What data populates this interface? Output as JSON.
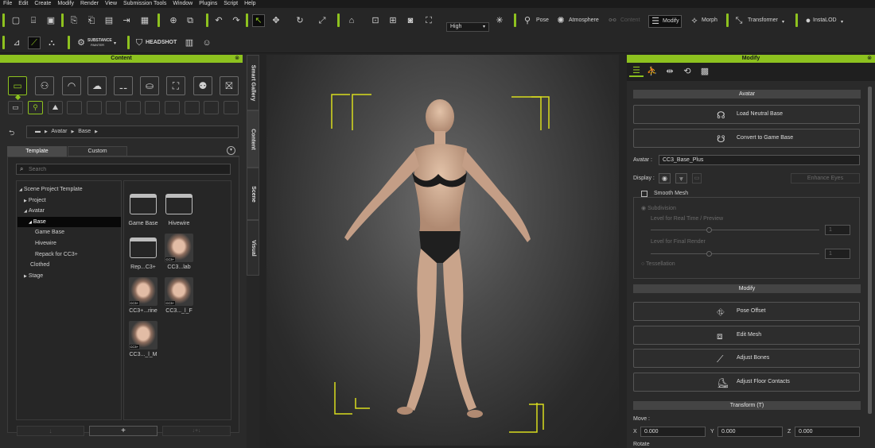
{
  "menu": [
    "File",
    "Edit",
    "Create",
    "Modify",
    "Render",
    "View",
    "Submission Tools",
    "Window",
    "Plugins",
    "Script",
    "Help"
  ],
  "toolbar": {
    "quality_value": "High",
    "pose_label": "Pose",
    "atmosphere_label": "Atmosphere",
    "content_label": "Content",
    "modify_label": "Modify",
    "morph_label": "Morph",
    "transformer_label": "Transformer",
    "instalod_label": "InstaLOD",
    "substance_label": "SUBSTANCE",
    "substance_sub": "PAINTER",
    "headshot_label": "HEADSHOT"
  },
  "content_panel": {
    "title": "Content",
    "breadcrumb": [
      "Avatar",
      "Base"
    ],
    "tabs": [
      "Template",
      "Custom"
    ],
    "search_placeholder": "Search",
    "tree": [
      {
        "label": "Scene Project Template",
        "indent": 0,
        "arrow": "◢"
      },
      {
        "label": "Project",
        "indent": 1,
        "arrow": "▶"
      },
      {
        "label": "Avatar",
        "indent": 1,
        "arrow": "◢"
      },
      {
        "label": "Base",
        "indent": 2,
        "arrow": "◢",
        "selected": true
      },
      {
        "label": "Game Base",
        "indent": 3,
        "arrow": ""
      },
      {
        "label": "Hivewire",
        "indent": 3,
        "arrow": ""
      },
      {
        "label": "Repack for CC3+",
        "indent": 3,
        "arrow": ""
      },
      {
        "label": "Clothed",
        "indent": 2,
        "arrow": ""
      },
      {
        "label": "Stage",
        "indent": 1,
        "arrow": "▶"
      }
    ],
    "items": [
      {
        "caption": "Game Base",
        "kind": "folder"
      },
      {
        "caption": "Hivewire",
        "kind": "folder"
      },
      {
        "caption": "Rep...C3+",
        "kind": "folder"
      },
      {
        "caption": "CC3...lab",
        "kind": "face",
        "tag": "CC3+"
      },
      {
        "caption": "CC3+...rine",
        "kind": "face",
        "tag": "CC3+"
      },
      {
        "caption": "CC3..._l_F",
        "kind": "face",
        "tag": "CC3+"
      },
      {
        "caption": "CC3..._l_M",
        "kind": "face",
        "tag": "CC3+"
      }
    ],
    "bottom_buttons": [
      "↓",
      "+",
      "↓+↓"
    ]
  },
  "side_tabs": [
    "Smart Gallery",
    "Content",
    "Scene",
    "Visual"
  ],
  "modify_panel": {
    "title": "Modify",
    "avatar_section": "Avatar",
    "load_neutral_base": "Load Neutral Base",
    "convert_to_game_base": "Convert to Game Base",
    "avatar_label": "Avatar :",
    "avatar_value": "CC3_Base_Plus",
    "display_label": "Display :",
    "enhance_eyes": "Enhance Eyes",
    "smooth_mesh": "Smooth Mesh",
    "subdivision": "Subdivision",
    "level_realtime": "Level for Real Time / Preview",
    "level_final": "Level for Final Render",
    "level_value_1": "1",
    "level_value_2": "1",
    "tessellation": "Tessellation",
    "modify_section": "Modify",
    "pose_offset": "Pose Offset",
    "edit_mesh": "Edit Mesh",
    "adjust_bones": "Adjust Bones",
    "adjust_floor_contacts": "Adjust Floor Contacts",
    "transform_section": "Transform  (T)",
    "move_label": "Move :",
    "x_label": "X",
    "x_value": "0.000",
    "y_label": "Y",
    "y_value": "0.000",
    "z_label": "Z",
    "z_value": "0.000",
    "rotate_label": "Rotate"
  },
  "colors": {
    "accent": "#8dc21f",
    "bg": "#2a2a2a",
    "yellow_frame": "#d8dc1e"
  }
}
